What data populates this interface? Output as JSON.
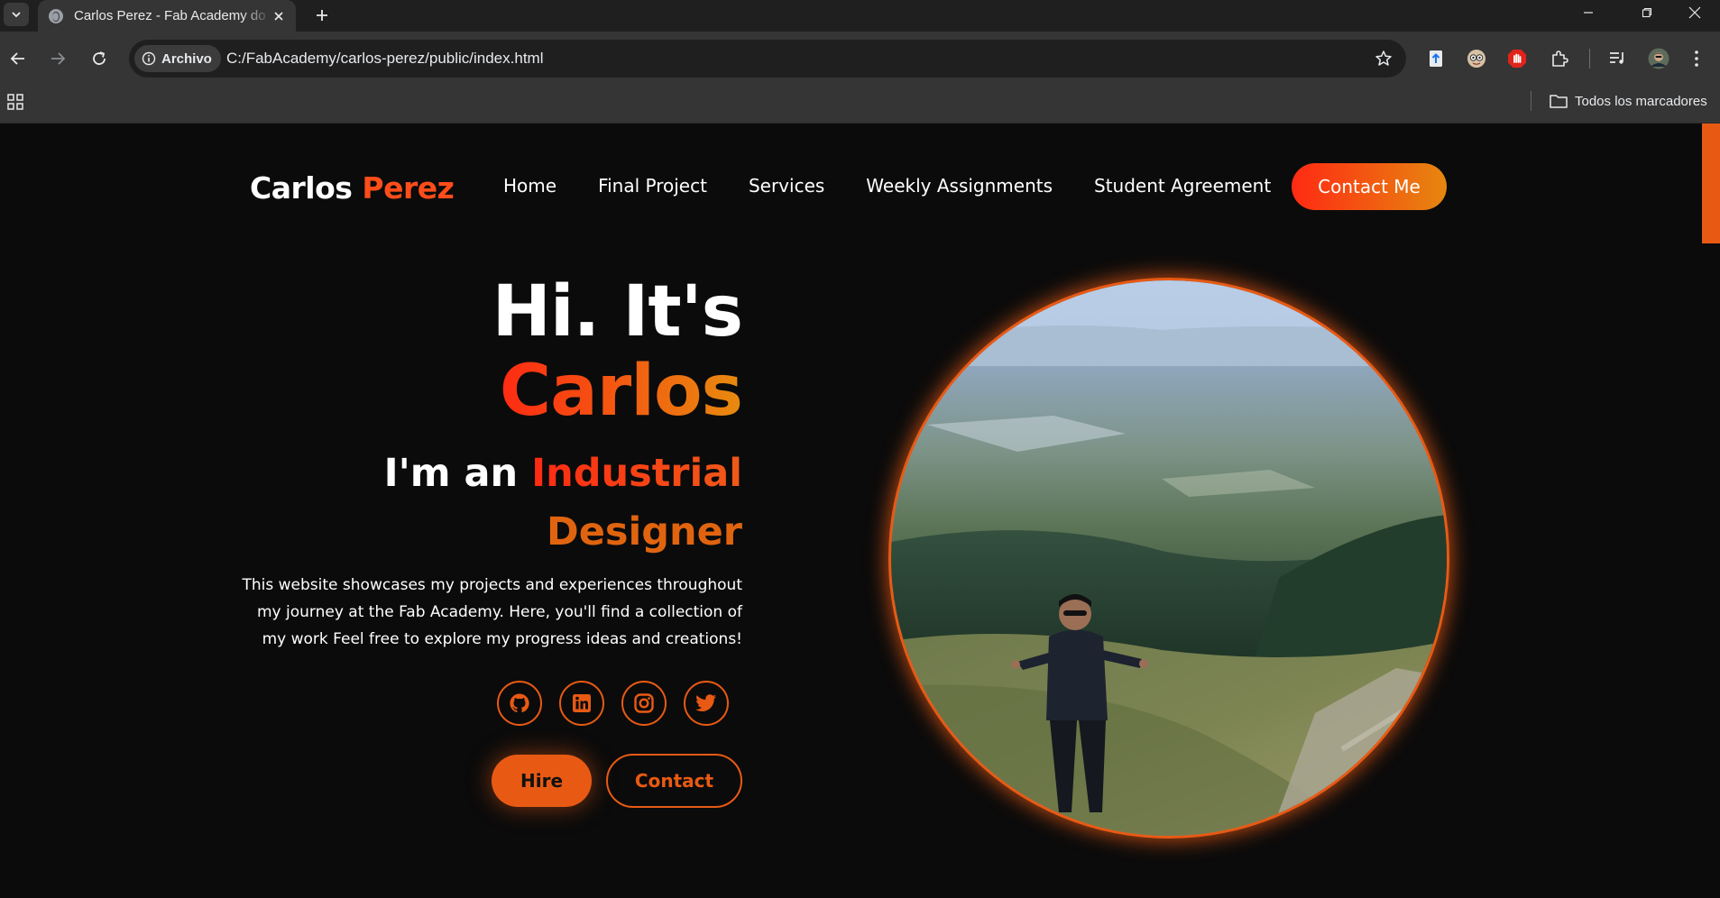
{
  "browser": {
    "tab_title": "Carlos Perez - Fab Academy do",
    "omnibox_chip": "Archivo",
    "url": "C:/FabAcademy/carlos-perez/public/index.html",
    "bookmarks_all": "Todos los marcadores"
  },
  "site": {
    "logo_first": "Carlos",
    "logo_second": "Perez",
    "nav": [
      "Home",
      "Final Project",
      "Services",
      "Weekly Assignments",
      "Student Agreement"
    ],
    "cta": "Contact Me"
  },
  "hero": {
    "greeting": "Hi. It's",
    "name": "Carlos",
    "role_prefix": "I'm an",
    "role_highlight": "Industrial",
    "role_second_line": "Designer",
    "bio": "This website showcases my projects and experiences throughout my journey at the Fab Academy. Here, you'll find a collection of my work Feel free to explore my progress ideas and creations!",
    "socials": [
      "github-icon",
      "linkedin-icon",
      "instagram-icon",
      "twitter-icon"
    ],
    "hire_label": "Hire",
    "contact_label": "Contact"
  },
  "colors": {
    "accent": "#e85a14",
    "gradient_start": "#ff2a13",
    "gradient_end": "#e6870f",
    "background": "#0b0b0b"
  }
}
